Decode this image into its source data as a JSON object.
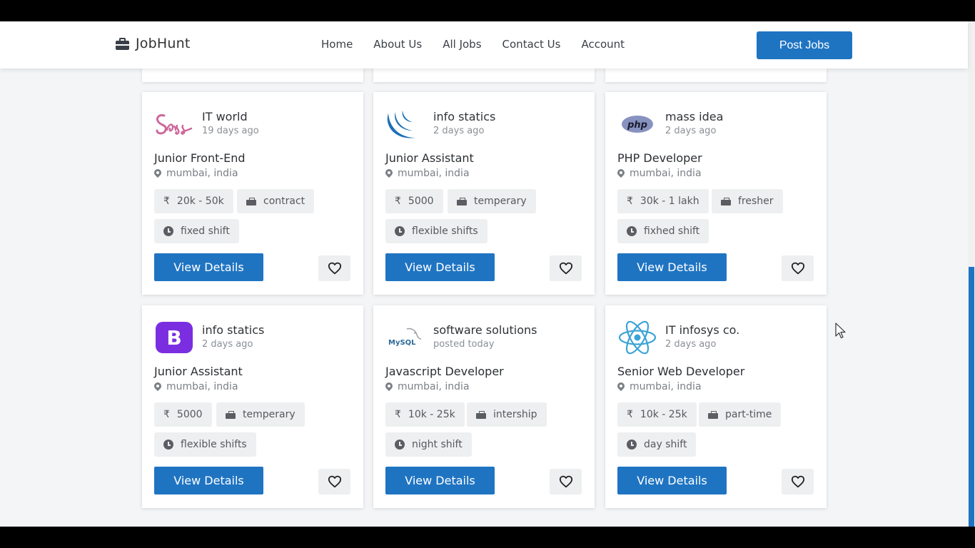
{
  "brand": {
    "name": "JobHunt",
    "icon": "briefcase-icon"
  },
  "nav": [
    "Home",
    "About Us",
    "All Jobs",
    "Contact Us",
    "Account"
  ],
  "post_jobs_label": "Post Jobs",
  "colors": {
    "accent": "#1f74c2",
    "background": "#f4f5f7",
    "tag_bg": "#eeeff0"
  },
  "cards": [
    {
      "logo": "sass-logo",
      "company": "IT world",
      "posted": "19 days ago",
      "title": "Junior Front-End",
      "location": "mumbai, india",
      "salary": "20k - 50k",
      "type": "contract",
      "shift": "fixed shift",
      "button": "View Details"
    },
    {
      "logo": "jquery-logo",
      "company": "info statics",
      "posted": "2 days ago",
      "title": "Junior Assistant",
      "location": "mumbai, india",
      "salary": "5000",
      "type": "temperary",
      "shift": "flexible shifts",
      "button": "View Details"
    },
    {
      "logo": "php-logo",
      "logo_text": "php",
      "company": "mass idea",
      "posted": "2 days ago",
      "title": "PHP Developer",
      "location": "mumbai, india",
      "salary": "30k - 1 lakh",
      "type": "fresher",
      "shift": "fixhed shift",
      "button": "View Details"
    },
    {
      "logo": "bootstrap-logo",
      "logo_text": "B",
      "company": "info statics",
      "posted": "2 days ago",
      "title": "Junior Assistant",
      "location": "mumbai, india",
      "salary": "5000",
      "type": "temperary",
      "shift": "flexible shifts",
      "button": "View Details"
    },
    {
      "logo": "mysql-logo",
      "logo_text": "MySQL",
      "company": "software solutions",
      "posted": "posted today",
      "title": "Javascript Developer",
      "location": "mumbai, india",
      "salary": "10k - 25k",
      "type": "intership",
      "shift": "night shift",
      "button": "View Details"
    },
    {
      "logo": "react-logo",
      "company": "IT infosys co.",
      "posted": "2 days ago",
      "title": "Senior Web Developer",
      "location": "mumbai, india",
      "salary": "10k - 25k",
      "type": "part-time",
      "shift": "day shift",
      "button": "View Details"
    }
  ]
}
